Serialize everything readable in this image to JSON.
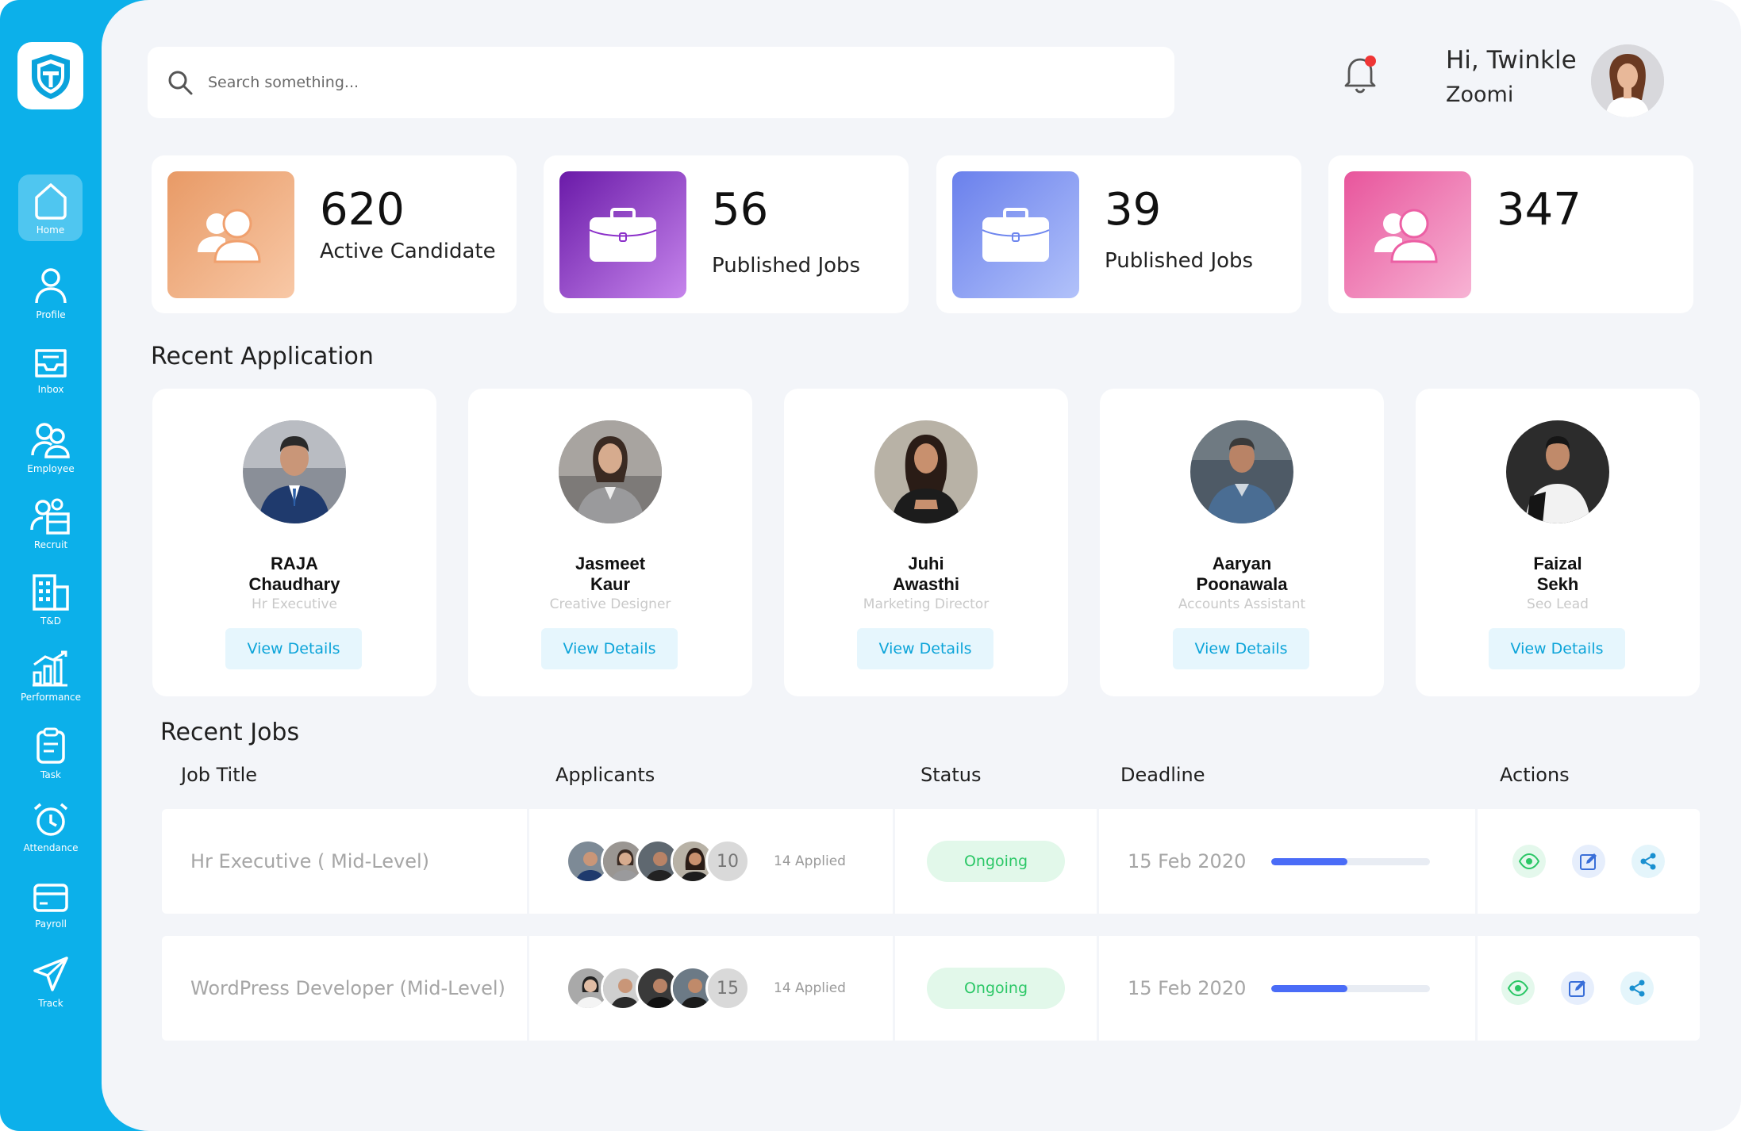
{
  "search": {
    "placeholder": "Search something..."
  },
  "user": {
    "greeting": "Hi, Twinkle",
    "company": "Zoomi"
  },
  "sidebar": {
    "items": [
      {
        "label": "Home",
        "icon": "home-icon"
      },
      {
        "label": "Profile",
        "icon": "user-icon"
      },
      {
        "label": "Inbox",
        "icon": "inbox-icon"
      },
      {
        "label": "Employee",
        "icon": "users-icon"
      },
      {
        "label": "Recruit",
        "icon": "recruit-icon"
      },
      {
        "label": "T&D",
        "icon": "building-icon"
      },
      {
        "label": "Performance",
        "icon": "chart-icon"
      },
      {
        "label": "Task",
        "icon": "clipboard-icon"
      },
      {
        "label": "Attendance",
        "icon": "alarm-clock-icon"
      },
      {
        "label": "Payroll",
        "icon": "card-icon"
      },
      {
        "label": "Track",
        "icon": "send-icon"
      }
    ]
  },
  "stats": [
    {
      "value": "620",
      "label": "Active Candidate",
      "color": "#f0a06e"
    },
    {
      "value": "56",
      "label": "Published Jobs",
      "color": "#8b2fc9"
    },
    {
      "value": "39",
      "label": "Published Jobs",
      "color": "#6e86ee"
    },
    {
      "value": "347",
      "label": "",
      "color": "#ec5fa4"
    }
  ],
  "recent_application": {
    "title": "Recent Application",
    "button_label": "View Details",
    "applicants": [
      {
        "first": "RAJA",
        "last": "Chaudhary",
        "role": "Hr Executive"
      },
      {
        "first": "Jasmeet",
        "last": "Kaur",
        "role": "Creative Designer"
      },
      {
        "first": "Juhi",
        "last": "Awasthi",
        "role": "Marketing Director"
      },
      {
        "first": "Aaryan",
        "last": "Poonawala",
        "role": "Accounts Assistant"
      },
      {
        "first": "Faizal",
        "last": "Sekh",
        "role": "Seo Lead"
      }
    ]
  },
  "recent_jobs": {
    "title": "Recent Jobs",
    "columns": [
      "Job Title",
      "Applicants",
      "Status",
      "Deadline",
      "Actions"
    ],
    "rows": [
      {
        "title": "Hr Executive ( Mid-Level)",
        "extra_count": "10",
        "applied": "14 Applied",
        "status": "Ongoing",
        "deadline": "15 Feb 2020",
        "progress": 0.48
      },
      {
        "title": "WordPress Developer (Mid-Level)",
        "extra_count": "15",
        "applied": "14 Applied",
        "status": "Ongoing",
        "deadline": "15 Feb 2020",
        "progress": 0.48
      }
    ]
  }
}
